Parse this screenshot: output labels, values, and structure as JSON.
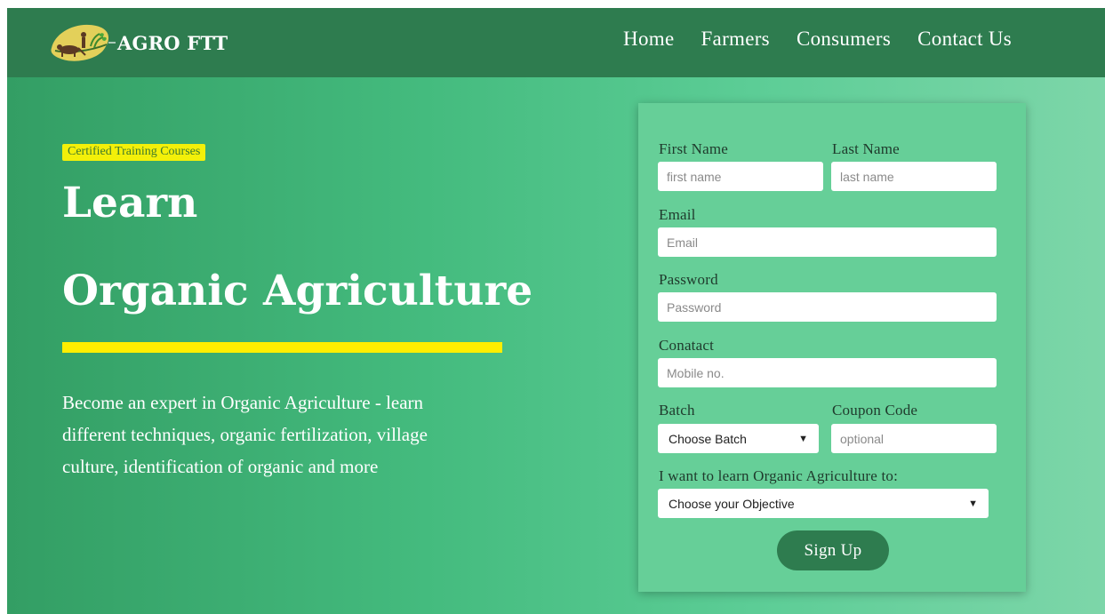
{
  "nav": {
    "brand": "AGRO FTT",
    "links": [
      "Home",
      "Farmers",
      "Consumers",
      "Contact Us"
    ]
  },
  "hero": {
    "badge": "Certified Training Courses",
    "title_line1": "Learn",
    "title_line2": "Organic Agriculture",
    "description": "Become an expert in Organic Agriculture - learn different techniques, organic fertilization, village culture, identification of organic and more"
  },
  "form": {
    "first_name_label": "First Name",
    "first_name_placeholder": "first name",
    "last_name_label": "Last Name",
    "last_name_placeholder": "last name",
    "email_label": "Email",
    "email_placeholder": "Email",
    "password_label": "Password",
    "password_placeholder": "Password",
    "contact_label": "Conatact",
    "contact_placeholder": "Mobile no.",
    "batch_label": "Batch",
    "batch_selected": "Choose Batch",
    "coupon_label": "Coupon Code",
    "coupon_placeholder": "optional",
    "objective_label": "I want to learn Organic Agriculture to:",
    "objective_selected": "Choose your Objective",
    "submit_label": "Sign Up"
  },
  "colors": {
    "navbar": "#2e7c4f",
    "accent_yellow": "#ffee00",
    "button": "#2e7c4f"
  }
}
